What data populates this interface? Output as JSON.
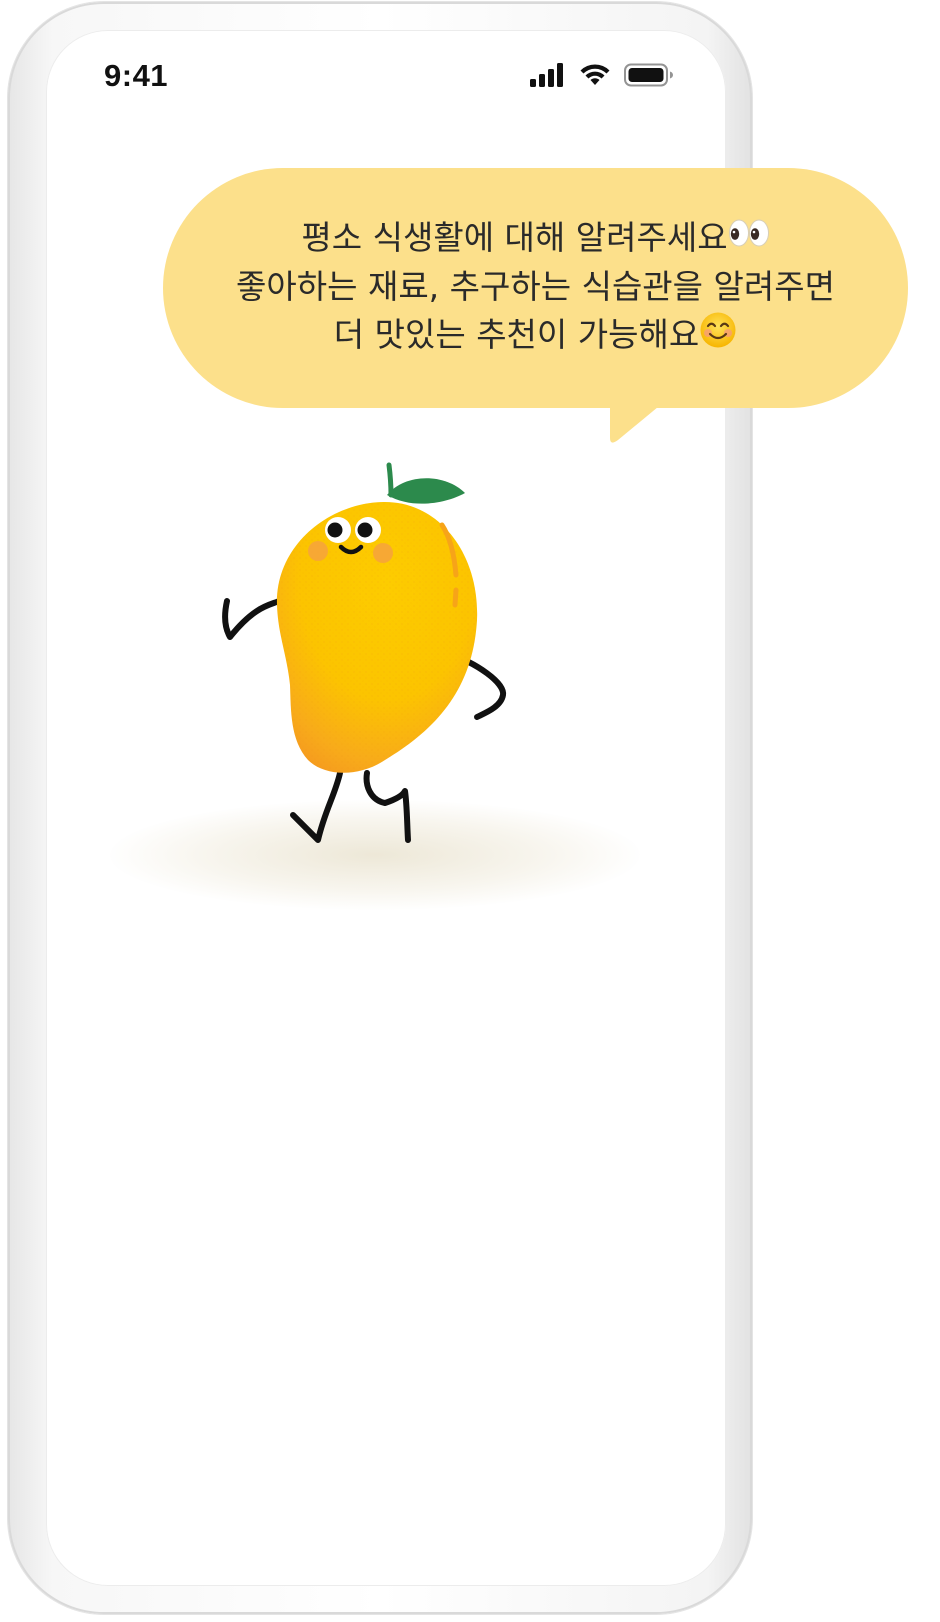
{
  "status_bar": {
    "time": "9:41",
    "icons": [
      "cellular-signal-icon",
      "wifi-icon",
      "battery-icon"
    ]
  },
  "speech_bubble": {
    "lines": [
      "평소 식생활에 대해 알려주세요",
      "좋아하는 재료, 추구하는 식습관을 알려주면",
      "더 맛있는 추천이 가능해요"
    ],
    "line1_emoji": "eyes-emoji",
    "line3_emoji": "smiling-face-emoji"
  },
  "mascot": {
    "character": "mango-character"
  },
  "colors": {
    "bubble": "#fce08b",
    "mango_body": "#fcc400",
    "mango_shade": "#f5a51c",
    "leaf": "#2c8a4c",
    "cheek": "#f6a43a",
    "text": "#2a2a2a"
  }
}
